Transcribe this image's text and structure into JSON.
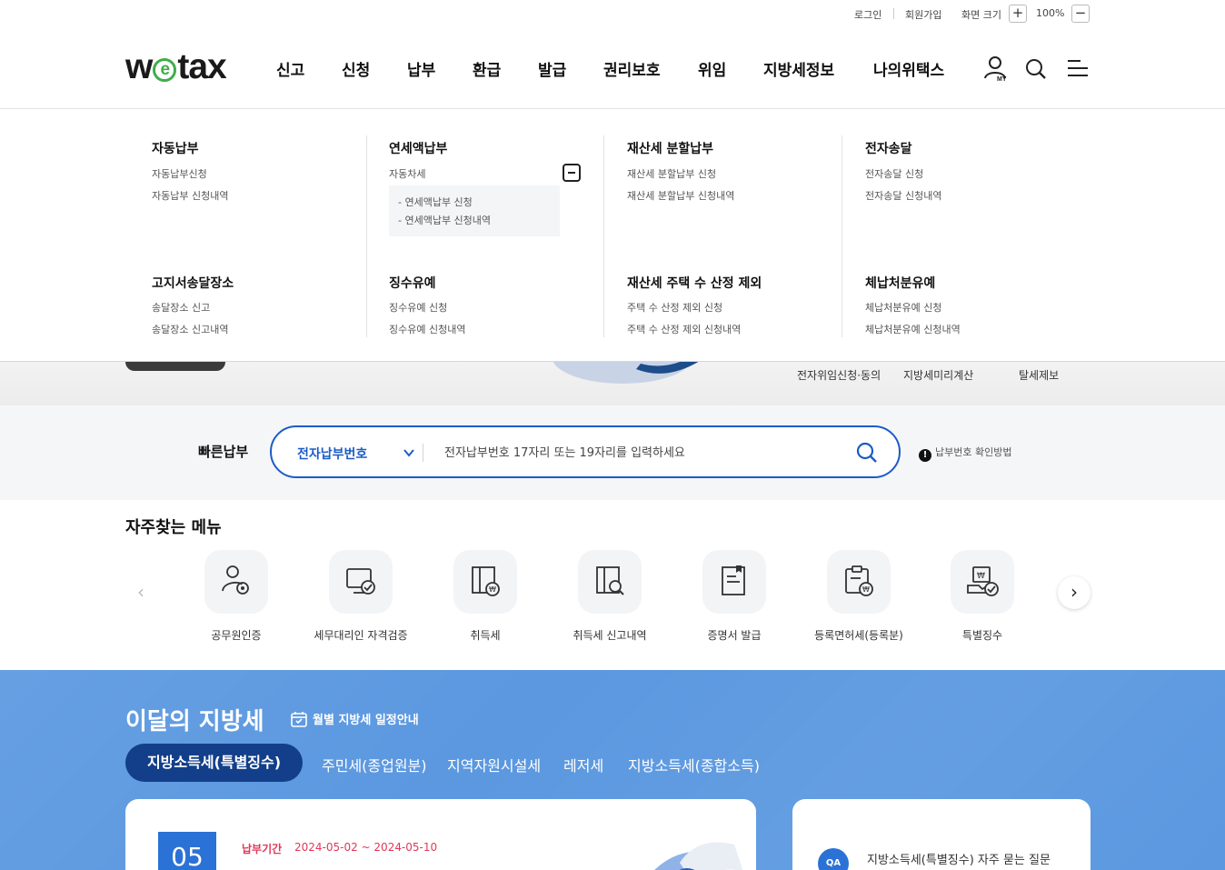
{
  "utility": {
    "login": "로그인",
    "signup": "회원가입",
    "zoom_label": "화면 크기",
    "zoom_in": "+",
    "zoom_value": "100%",
    "zoom_out": "−"
  },
  "header": {
    "logo_pre": "w",
    "logo_e": "e",
    "logo_post": "tax",
    "nav": [
      "신고",
      "신청",
      "납부",
      "환급",
      "발급",
      "권리보호",
      "위임",
      "지방세정보",
      "나의위택스"
    ]
  },
  "mega_menu": {
    "columns": [
      {
        "title": "자동납부",
        "links": [
          "자동납부신청",
          "자동납부 신청내역"
        ]
      },
      {
        "title": "연세액납부",
        "links": [
          "자동차세"
        ],
        "sub_links": [
          "- 연세액납부 신청",
          "- 연세액납부 신청내역"
        ]
      },
      {
        "title": "재산세 분할납부",
        "links": [
          "재산세 분할납부 신청",
          "재산세 분할납부 신청내역"
        ]
      },
      {
        "title": "전자송달",
        "links": [
          "전자송달 신청",
          "전자송달 신청내역"
        ]
      },
      {
        "title": "고지서송달장소",
        "links": [
          "송달장소 신고",
          "송달장소 신고내역"
        ]
      },
      {
        "title": "징수유예",
        "links": [
          "징수유예 신청",
          "징수유예 신청내역"
        ]
      },
      {
        "title": "재산세 주택 수 산정 제외",
        "links": [
          "주택 수 산정 제외 신청",
          "주택 수 산정 제외 신청내역"
        ]
      },
      {
        "title": "체납처분유예",
        "links": [
          "체납처분유예 신청",
          "체납처분유예 신청내역"
        ]
      }
    ]
  },
  "quick_links": [
    "전자위임신청·동의",
    "지방세미리계산",
    "탈세제보"
  ],
  "fast_pay": {
    "label": "빠른납부",
    "select_value": "전자납부번호",
    "placeholder": "전자납부번호 17자리 또는 19자리를 입력하세요",
    "help": "납부번호 확인방법"
  },
  "frequent": {
    "title": "자주찾는 메뉴",
    "items": [
      {
        "label": "공무원인증",
        "icon": "official-cert-icon"
      },
      {
        "label": "세무대리인 자격검증",
        "icon": "agent-verify-icon"
      },
      {
        "label": "취득세",
        "icon": "acquisition-tax-icon"
      },
      {
        "label": "취득세 신고내역",
        "icon": "acquisition-history-icon"
      },
      {
        "label": "증명서 발급",
        "icon": "certificate-icon"
      },
      {
        "label": "등록면허세(등록분)",
        "icon": "registration-tax-icon"
      },
      {
        "label": "특별징수",
        "icon": "special-collection-icon"
      }
    ]
  },
  "monthly": {
    "title": "이달의 지방세",
    "schedule_link": "월별 지방세 일정안내",
    "tabs": [
      "지방소득세(특별징수)",
      "주민세(종업원분)",
      "지역자원시설세",
      "레저세",
      "지방소득세(종합소득)"
    ],
    "card": {
      "month": "05",
      "due_label": "납부기간",
      "due_value": "2024-05-02 ~ 2024-05-10"
    },
    "faq": {
      "badge": "QA",
      "text": "지방소득세(특별징수) 자주 묻는 질문"
    }
  },
  "colors": {
    "brand_green": "#3fae49",
    "primary_blue": "#1b5cc6",
    "monthly_bg": "#5b98e0",
    "active_tab": "#133f8a",
    "due_pink": "#e0385a"
  }
}
